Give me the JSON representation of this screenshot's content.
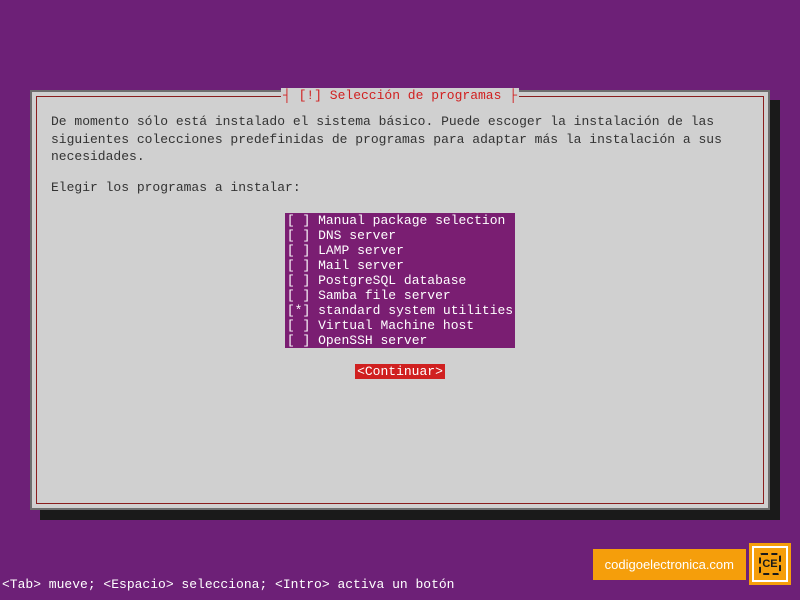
{
  "dialog": {
    "title": "┤ [!] Selección de programas ├",
    "body": "De momento sólo está instalado el sistema básico. Puede escoger la instalación de las siguientes colecciones predefinidas de programas para adaptar más la instalación a sus necesidades.",
    "prompt": "Elegir los programas a instalar:",
    "options": [
      {
        "checked": false,
        "label": "Manual package selection "
      },
      {
        "checked": false,
        "label": "DNS server               "
      },
      {
        "checked": false,
        "label": "LAMP server              "
      },
      {
        "checked": false,
        "label": "Mail server              "
      },
      {
        "checked": false,
        "label": "PostgreSQL database      "
      },
      {
        "checked": false,
        "label": "Samba file server        "
      },
      {
        "checked": true,
        "label": "standard system utilities"
      },
      {
        "checked": false,
        "label": "Virtual Machine host     "
      },
      {
        "checked": false,
        "label": "OpenSSH server           "
      }
    ],
    "continue_label": "<Continuar>"
  },
  "hint": "<Tab> mueve; <Espacio> selecciona; <Intro> activa un botón",
  "watermark": {
    "text": "codigoelectronica.com",
    "icon_letters": "CE"
  },
  "colors": {
    "bg": "#6d2077",
    "panel": "#d0d0d0",
    "accent_red": "#d02020",
    "highlight_purple": "#7a1e72",
    "wm_orange": "#f59e0b"
  }
}
